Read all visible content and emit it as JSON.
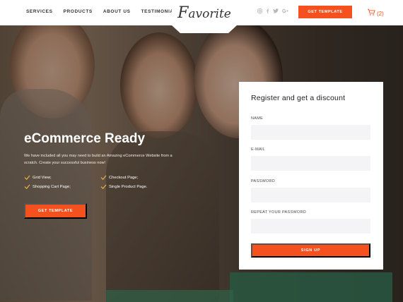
{
  "nav": [
    "SERVICES",
    "PRODUCTS",
    "ABOUT US",
    "TESTIMONIALS"
  ],
  "logo": {
    "initial": "F",
    "rest": "avorite"
  },
  "socials": [
    "instagram-icon",
    "facebook-icon",
    "twitter-icon",
    "google-plus-icon"
  ],
  "header_cta": "GET TEMPLATE",
  "cart": {
    "count": "(2)"
  },
  "hero": {
    "title": "eCommerce Ready",
    "description": "We have included all you may need to build an Amazing eCommerce Website from a scratch. Create your successful business now!",
    "features": [
      "Grid View;",
      "Checkout Page;",
      "Shopping Cart Page;",
      "Single Product Page."
    ],
    "cta": "GET TEMPLATE"
  },
  "form": {
    "title": "Register and get a discount",
    "fields": [
      {
        "label": "NAME",
        "value": ""
      },
      {
        "label": "E-MAIL",
        "value": ""
      },
      {
        "label": "PASSWORD",
        "value": ""
      },
      {
        "label": "REPEAT YOUR PASSWORD",
        "value": ""
      }
    ],
    "submit": "SIGN UP"
  },
  "colors": {
    "accent": "#f4511e",
    "header_bg": "#ffffff",
    "input_bg": "#f4f3f6"
  }
}
